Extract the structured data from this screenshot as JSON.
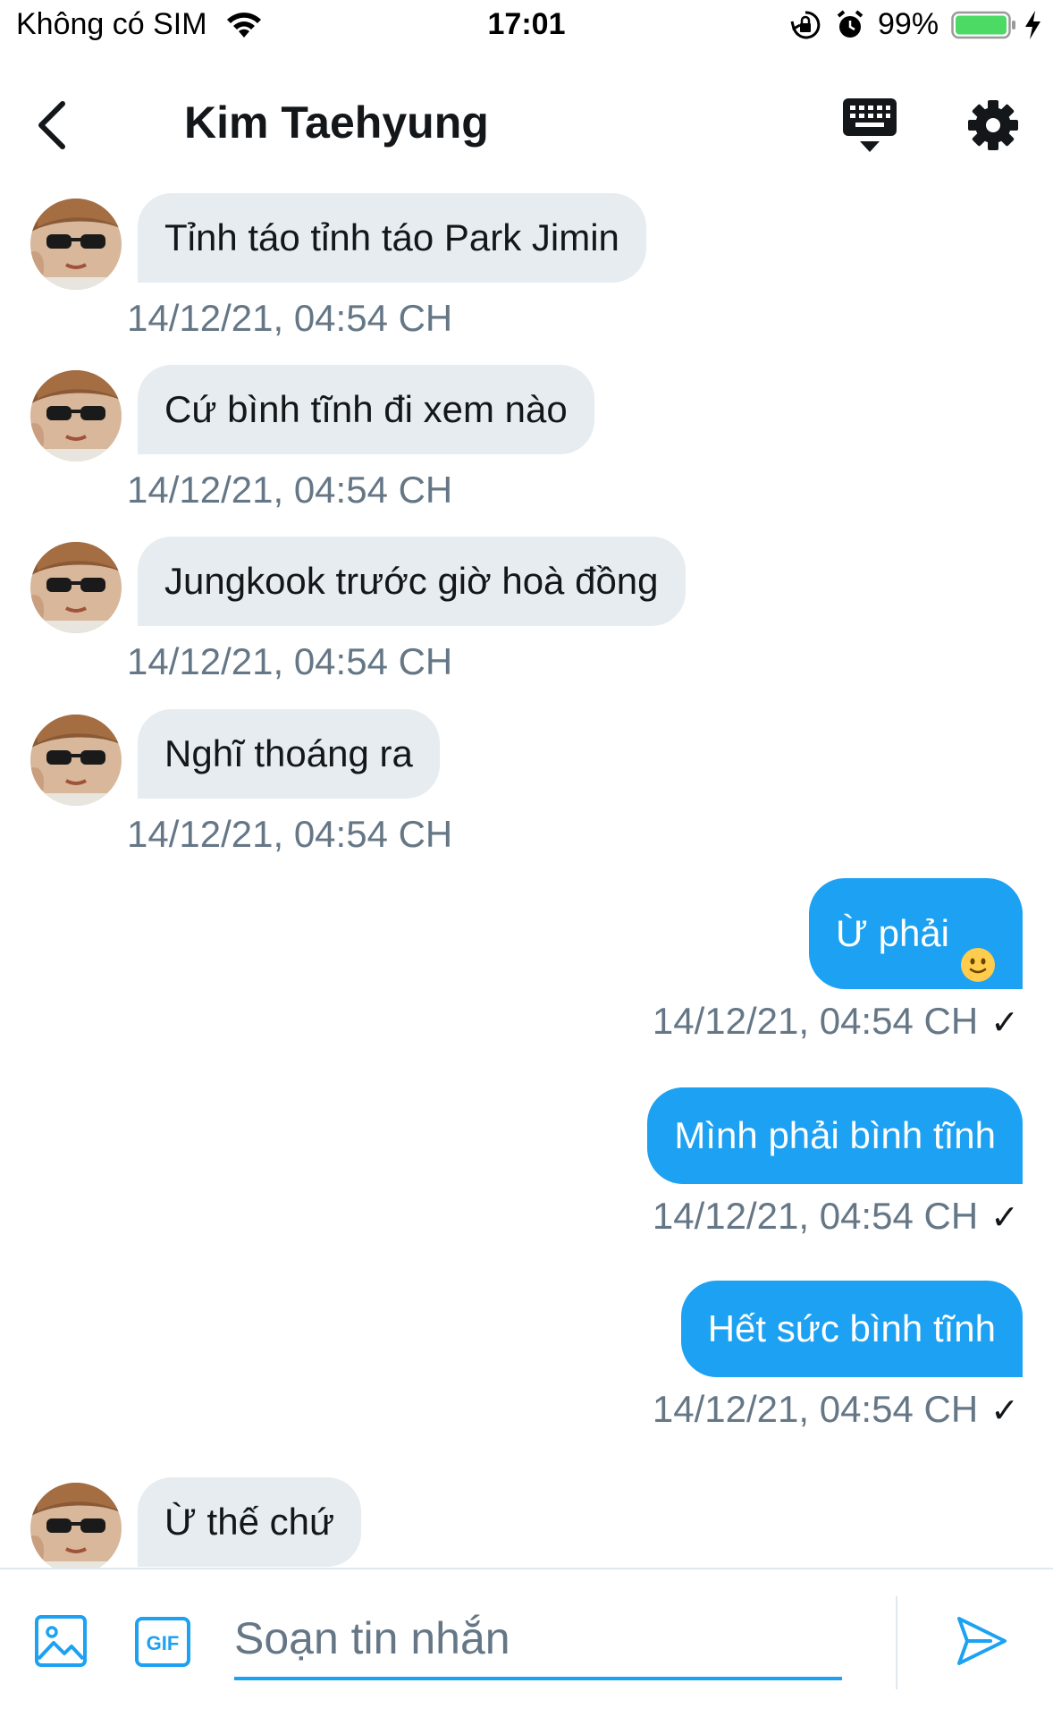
{
  "status_bar": {
    "carrier": "Không có SIM",
    "time": "17:01",
    "battery_percent": "99%"
  },
  "header": {
    "title": "Kim Taehyung",
    "back_icon": "chevron-left-icon",
    "keyboard_icon": "keyboard-icon",
    "settings_icon": "gear-icon"
  },
  "messages": [
    {
      "direction": "incoming",
      "text": "Tỉnh táo tỉnh táo Park Jimin",
      "timestamp": "14/12/21, 04:54 CH"
    },
    {
      "direction": "incoming",
      "text": "Cứ bình tĩnh đi xem nào",
      "timestamp": "14/12/21, 04:54 CH"
    },
    {
      "direction": "incoming",
      "text": "Jungkook trước giờ hoà đồng",
      "timestamp": "14/12/21, 04:54 CH"
    },
    {
      "direction": "incoming",
      "text": "Nghĩ thoáng ra",
      "timestamp": "14/12/21, 04:54 CH"
    },
    {
      "direction": "outgoing",
      "text": "Ừ phải",
      "emoji": "slightly-smiling-face-icon",
      "timestamp": "14/12/21, 04:54 CH",
      "status": "✓"
    },
    {
      "direction": "outgoing",
      "text": "Mình phải bình tĩnh",
      "timestamp": "14/12/21, 04:54 CH",
      "status": "✓"
    },
    {
      "direction": "outgoing",
      "text": "Hết sức bình tĩnh",
      "timestamp": "14/12/21, 04:54 CH",
      "status": "✓"
    },
    {
      "direction": "incoming",
      "text": "Ừ thế chứ"
    }
  ],
  "composer": {
    "placeholder": "Soạn tin nhắn",
    "value": "",
    "gif_label": "GIF"
  },
  "colors": {
    "accent": "#1da1f2",
    "incoming_bubble": "#e6ecf0",
    "secondary_text": "#657786",
    "battery": "#4cd964"
  }
}
